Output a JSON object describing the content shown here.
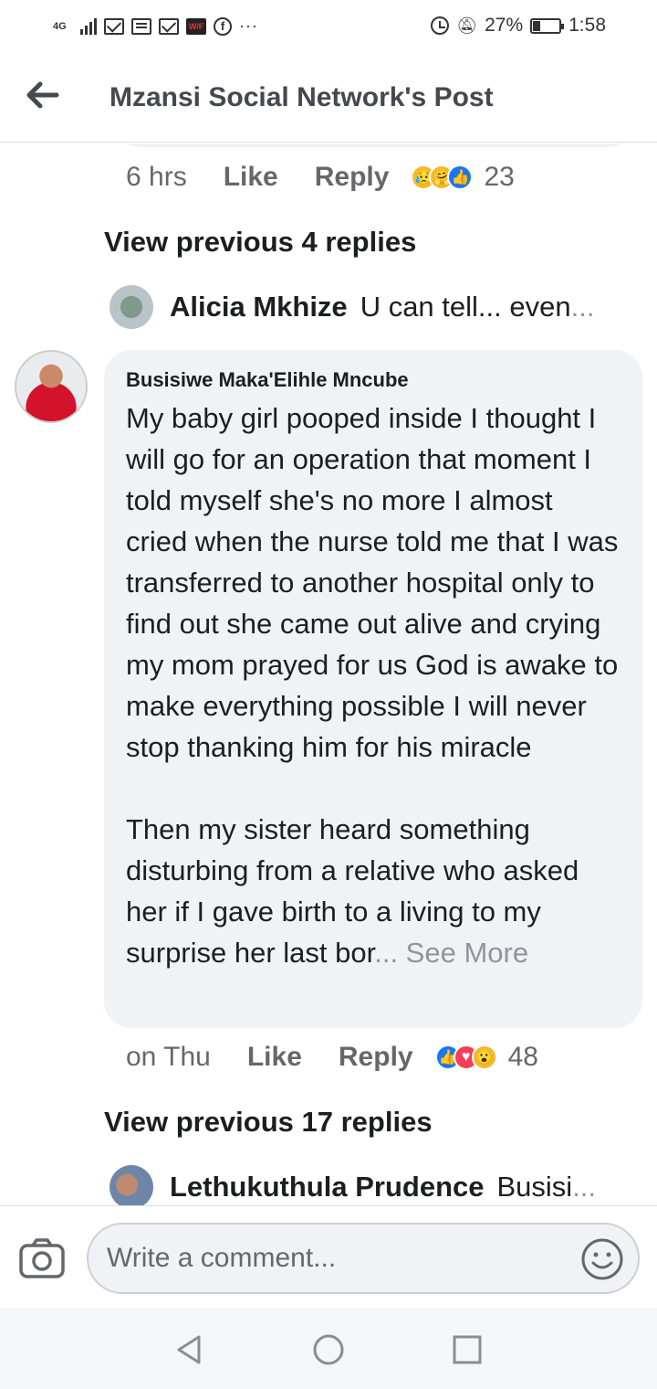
{
  "status_bar": {
    "network": "4G",
    "battery": "27%",
    "battery_level": 0.27,
    "time": "1:58",
    "icons": [
      "signal-icon",
      "mail-icon",
      "news-icon",
      "gmail-icon",
      "wf-app-icon",
      "facebook-icon",
      "more-icon",
      "alarm-icon",
      "mute-icon",
      "battery-icon"
    ]
  },
  "header": {
    "title": "Mzansi Social Network's Post"
  },
  "comment_top_meta": {
    "time": "6 hrs",
    "like_label": "Like",
    "reply_label": "Reply",
    "reactions": [
      "sad",
      "care",
      "like"
    ],
    "reaction_count": "23"
  },
  "view_previous_1": "View previous 4 replies",
  "reply_1": {
    "name": "Alicia Mkhize",
    "text": "U can tell... even",
    "ellipsis": "..."
  },
  "comment": {
    "author": "Busisiwe Maka'Elihle Mncube",
    "paragraph1": "My baby girl pooped inside I thought I will go for an operation that moment I told myself she's no more I almost cried when the nurse told me that I was transferred to another hospital only to find out she came out alive and crying my mom prayed for us God is awake to make everything possible I will never stop thanking him for his miracle",
    "paragraph2": "Then my sister heard something disturbing from a relative who asked her if I gave birth to a living to my surprise her last bor",
    "see_more": "... See More"
  },
  "comment_meta": {
    "time": "on Thu",
    "like_label": "Like",
    "reply_label": "Reply",
    "reactions": [
      "like",
      "love",
      "wow"
    ],
    "reaction_count": "48"
  },
  "view_previous_2": "View previous 17 replies",
  "reply_2": {
    "name": "Lethukuthula Prudence",
    "text": "Busisi",
    "ellipsis": "..."
  },
  "composer": {
    "placeholder": "Write a comment..."
  },
  "colors": {
    "bubble": "#f0f2f5",
    "like_blue": "#1877f2",
    "love_red": "#f33e58",
    "yellow": "#f7b928"
  }
}
